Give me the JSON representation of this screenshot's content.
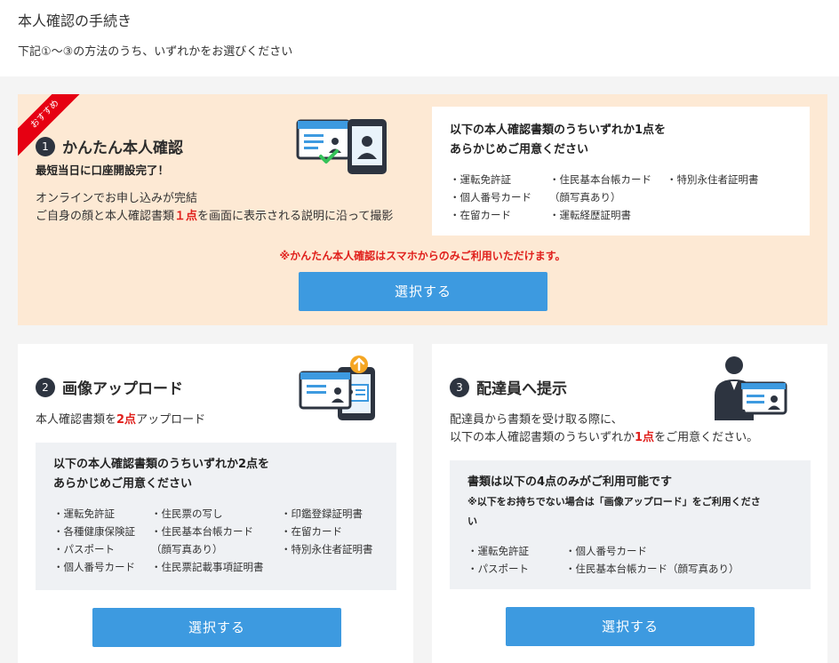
{
  "header": {
    "title": "本人確認の手続き",
    "subtitle": "下記①～③の方法のうち、いずれかをお選びください"
  },
  "option1": {
    "ribbon": "おすすめ",
    "number": "1",
    "title": "かんたん本人確認",
    "subtitle": "最短当日に口座開設完了！",
    "desc_line1": "オンラインでお申し込みが完結",
    "desc_line2_pre": "ご自身の顔と本人確認書類",
    "desc_line2_highlight": "１点",
    "desc_line2_post": "を画面に表示される説明に沿って撮影",
    "box_title_line1": "以下の本人確認書類のうちいずれか1点を",
    "box_title_line2": "あらかじめご用意ください",
    "documents": [
      "・運転免許証",
      "・住民基本台帳カード",
      "・特別永住者証明書",
      "・個人番号カード",
      "（顔写真あり）",
      "",
      "・在留カード",
      "・運転経歴証明書",
      ""
    ],
    "note": "※かんたん本人確認はスマホからのみご利用いただけます。",
    "button_label": "選択する"
  },
  "option2": {
    "number": "2",
    "title": "画像アップロード",
    "desc_pre": "本人確認書類を",
    "desc_highlight": "2点",
    "desc_post": "アップロード",
    "box_title_line1": "以下の本人確認書類のうちいずれか2点を",
    "box_title_line2": "あらかじめご用意ください",
    "documents": [
      "・運転免許証",
      "・住民票の写し",
      "・印鑑登録証明書",
      "・各種健康保険証",
      "・住民基本台帳カード",
      "・在留カード",
      "・パスポート",
      "（顔写真あり）",
      "・特別永住者証明書",
      "・個人番号カード",
      "・住民票記載事項証明書",
      ""
    ],
    "button_label": "選択する"
  },
  "option3": {
    "number": "3",
    "title": "配達員へ提示",
    "desc_line1": "配達員から書類を受け取る際に、",
    "desc_line2_pre": "以下の本人確認書類のうちいずれか",
    "desc_line2_highlight": "1点",
    "desc_line2_post": "をご用意ください。",
    "box_title": "書類は以下の4点のみがご利用可能です",
    "box_note_line1": "※以下をお持ちでない場合は「画像アップロード」をご利用くださ",
    "box_note_line2": "い",
    "documents": [
      "・運転免許証",
      "・個人番号カード",
      "・パスポート",
      "・住民基本台帳カード（顔写真あり）"
    ],
    "button_label": "選択する"
  },
  "colors": {
    "accent_button": "#3d9ae0",
    "highlight_red": "#e0201c",
    "recommend_bg": "#fde9d4",
    "ribbon": "#e60012",
    "badge": "#2d3440"
  }
}
